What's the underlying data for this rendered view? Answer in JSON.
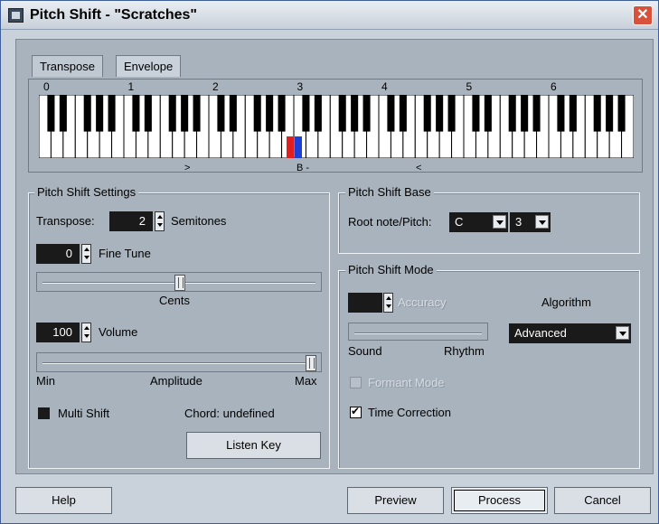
{
  "window": {
    "title": "Pitch Shift - \"Scratches\"",
    "close_glyph": "✕"
  },
  "tabs": [
    {
      "label": "Transpose"
    },
    {
      "label": "Envelope"
    }
  ],
  "keyboard": {
    "octave_labels": [
      "0",
      "1",
      "2",
      "3",
      "4",
      "5",
      "6"
    ],
    "marker_low": ">",
    "marker_root": "B -",
    "marker_high": "<",
    "highlight_root_color": "#e02020",
    "highlight_target_color": "#1c3fd8"
  },
  "pitch_shift_settings": {
    "title": "Pitch Shift Settings",
    "transpose_label": "Transpose:",
    "transpose_value": "2",
    "semitones_label": "Semitones",
    "fine_tune_value": "0",
    "fine_tune_label": "Fine Tune",
    "cents_label": "Cents",
    "fine_tune_level": 0.5,
    "volume_value": "100",
    "volume_label": "Volume",
    "amplitude_min": "Min",
    "amplitude_label": "Amplitude",
    "amplitude_max": "Max",
    "volume_level": 1.0,
    "multi_shift_label": "Multi Shift",
    "multi_shift_checked": false,
    "chord_label": "Chord: undefined",
    "listen_key_label": "Listen Key"
  },
  "pitch_shift_base": {
    "title": "Pitch Shift Base",
    "root_label": "Root note/Pitch:",
    "root_note": "C",
    "root_octave": "3"
  },
  "pitch_shift_mode": {
    "title": "Pitch Shift Mode",
    "accuracy_value": "",
    "accuracy_label": "Accuracy",
    "algorithm_label": "Algorithm",
    "algorithm_value": "Advanced",
    "sound_label": "Sound",
    "rhythm_label": "Rhythm",
    "formant_mode_label": "Formant Mode",
    "formant_mode_checked": false,
    "time_correction_label": "Time Correction",
    "time_correction_checked": true
  },
  "footer": {
    "help_label": "Help",
    "preview_label": "Preview",
    "process_label": "Process",
    "cancel_label": "Cancel"
  }
}
